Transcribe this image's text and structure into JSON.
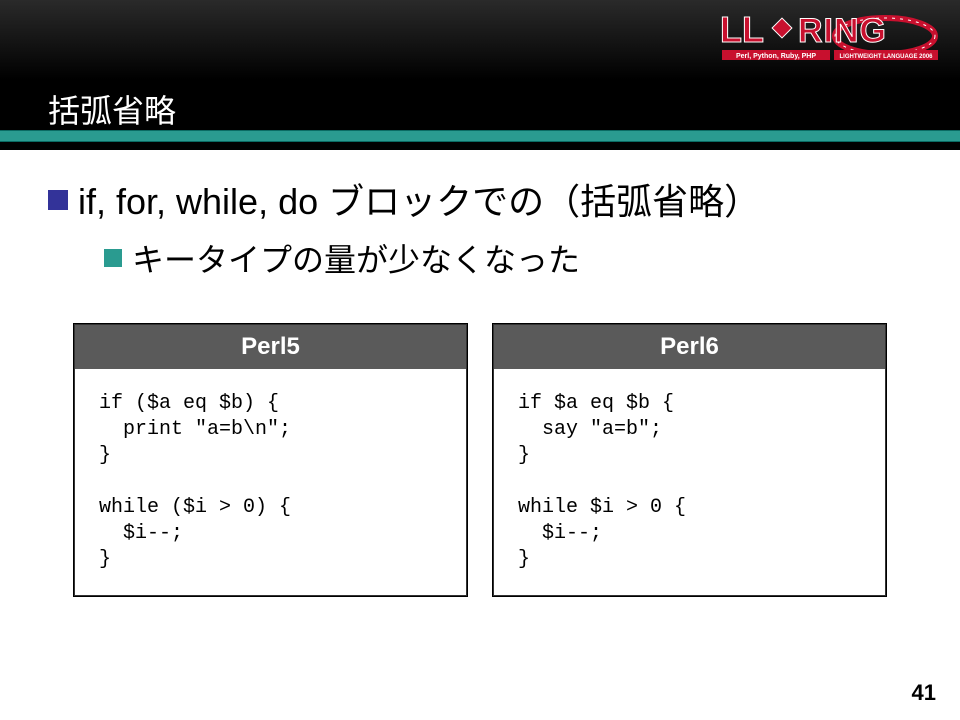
{
  "logo": {
    "top_text": "LL",
    "top_text2": "RING",
    "sub1": "Perl, Python, Ruby, PHP",
    "sub2": "LIGHTWEIGHT LANGUAGE 2006"
  },
  "title": "括弧省略",
  "bullet1": "if, for, while, do ブロックでの（括弧省略）",
  "sub_bullet1": "キータイプの量が少なくなった",
  "boxes": {
    "left": {
      "label": "Perl5",
      "code": "if ($a eq $b) {\n  print \"a=b\\n\";\n}\n\nwhile ($i > 0) {\n  $i--;\n}"
    },
    "right": {
      "label": "Perl6",
      "code": "if $a eq $b {\n  say \"a=b\";\n}\n\nwhile $i > 0 {\n  $i--;\n}"
    }
  },
  "page_number": "41"
}
